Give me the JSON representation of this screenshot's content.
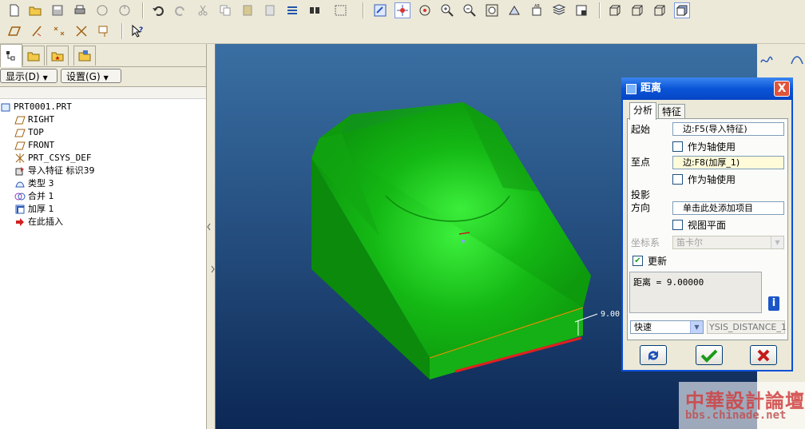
{
  "left_panel": {
    "show_button": "显示(D)",
    "settings_button": "设置(G)",
    "tree": [
      {
        "label": "PRT0001.PRT",
        "icon": "part-icon"
      },
      {
        "label": "RIGHT",
        "icon": "datum-plane-icon"
      },
      {
        "label": "TOP",
        "icon": "datum-plane-icon"
      },
      {
        "label": "FRONT",
        "icon": "datum-plane-icon"
      },
      {
        "label": "PRT_CSYS_DEF",
        "icon": "csys-icon"
      },
      {
        "label": "导入特征 标识39",
        "icon": "import-feature-icon"
      },
      {
        "label": "类型 3",
        "icon": "type-feature-icon"
      },
      {
        "label": "合并 1",
        "icon": "merge-icon"
      },
      {
        "label": "加厚 1",
        "icon": "thicken-icon"
      },
      {
        "label": "在此插入",
        "icon": "insert-here-arrow-icon"
      }
    ]
  },
  "dialog": {
    "title": "距离",
    "close": "X",
    "tabs": [
      "分析",
      "特征"
    ],
    "from_label": "起始",
    "from_value": "边:F5(导入特征)",
    "from_axis": "作为轴使用",
    "to_label": "至点",
    "to_value": "边:F8(加厚_1)",
    "to_axis": "作为轴使用",
    "projection_label": "投影",
    "direction_label": "方向",
    "direction_value": "单击此处添加项目",
    "view_plane": "视图平面",
    "csys_label": "坐标系",
    "csys_value": "笛卡尔",
    "update_label": "更新",
    "result": "距离 = 9.00000",
    "mode_value": "快速",
    "analysis_name": "YSIS_DISTANCE_1"
  },
  "viewport": {
    "dimension_text": "9.00"
  },
  "watermark": {
    "line1": "中華設計論壇",
    "line2": "bbs.chinade.net"
  },
  "colors": {
    "model": "#10b010",
    "title_bar": "#0a55d8",
    "viewport_top": "#3a6fa3",
    "viewport_bottom": "#0c2754"
  }
}
